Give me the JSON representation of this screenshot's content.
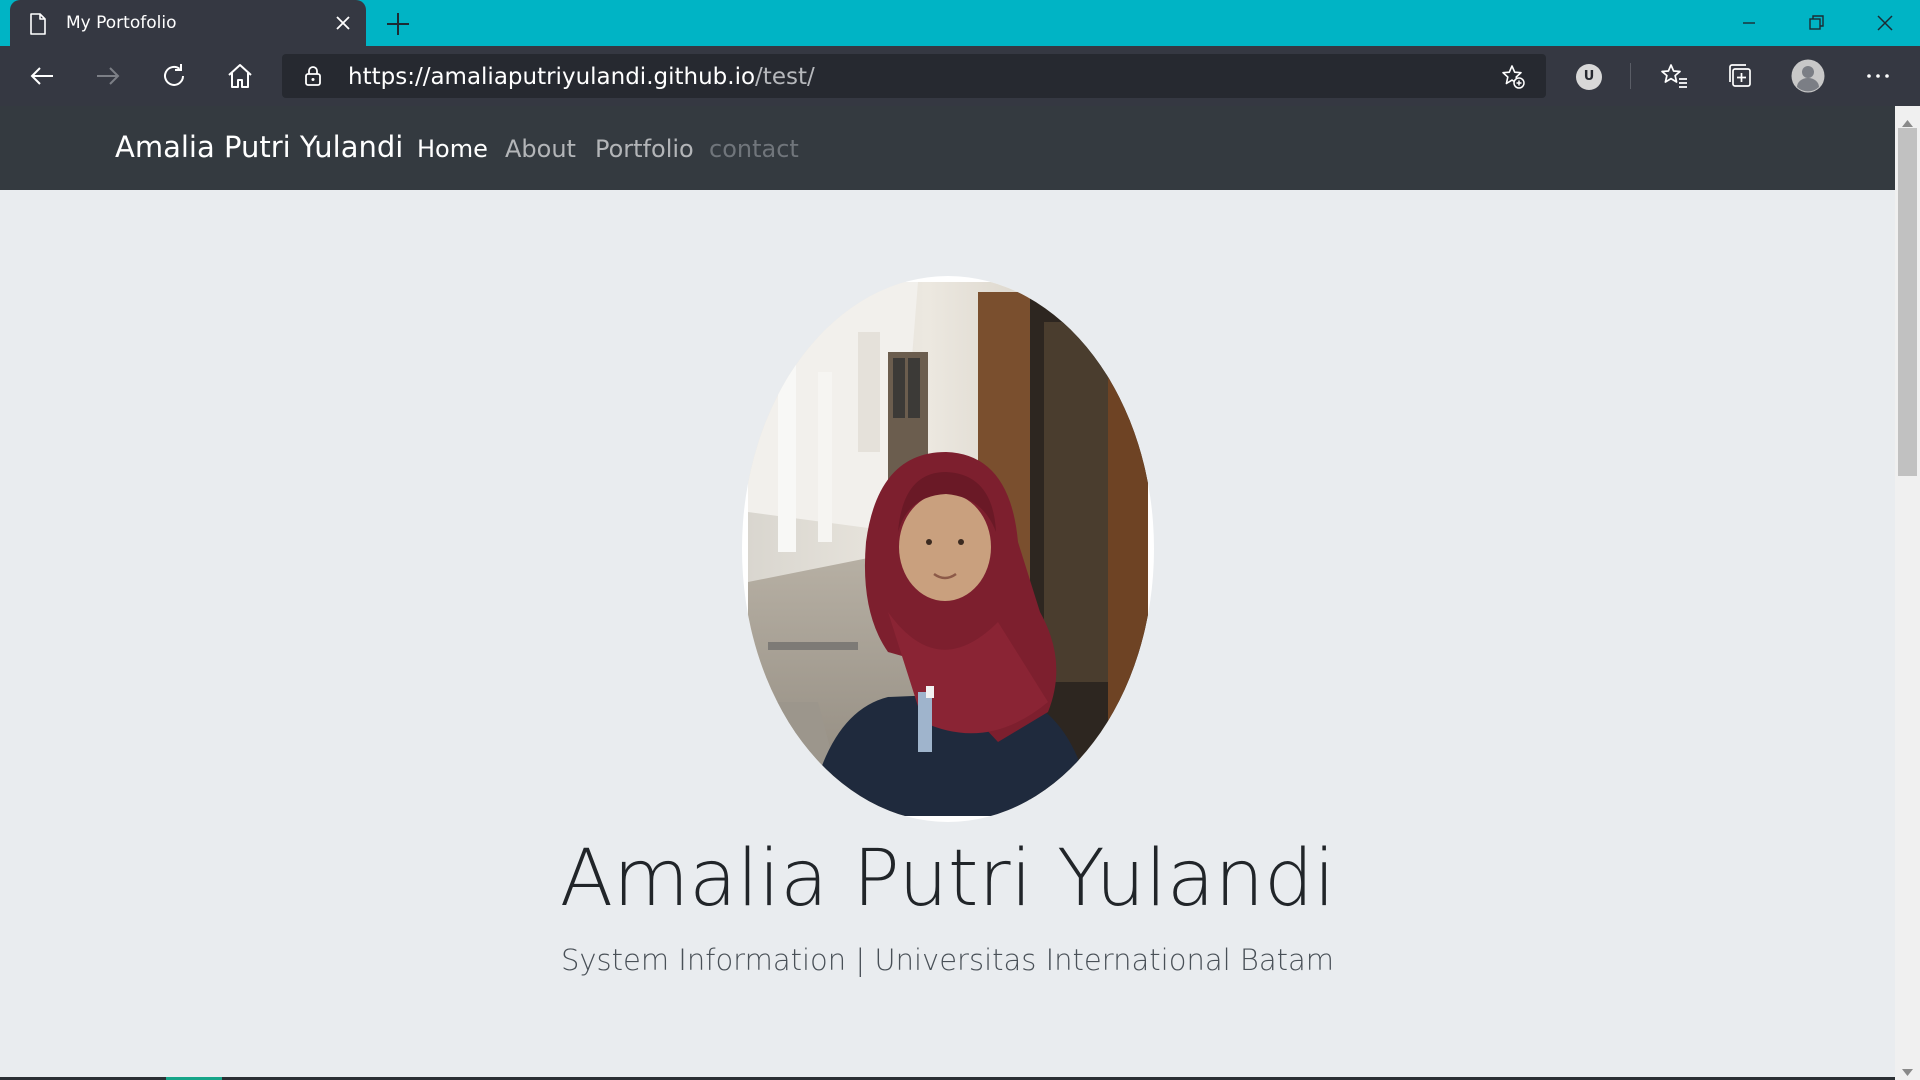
{
  "browser": {
    "tab_title": "My Portofolio",
    "url_host": "https://amaliaputriyulandi.github.io",
    "url_path": "/test/",
    "extension_label": "U",
    "tab_bg_color": "#353842",
    "titlebar_color": "#00b4c5",
    "icons": {
      "tab": "page-icon",
      "close_tab": "close-icon",
      "new_tab": "plus-icon",
      "minimize": "minimize-icon",
      "restore": "restore-icon",
      "close_window": "close-icon",
      "back": "back-arrow-icon",
      "forward": "forward-arrow-icon",
      "refresh": "refresh-icon",
      "home": "home-icon",
      "lock": "lock-icon",
      "add_favorite": "star-plus-icon",
      "favorites": "favorites-icon",
      "collections": "collections-icon",
      "profile": "profile-avatar-icon",
      "menu": "more-icon"
    }
  },
  "navbar": {
    "brand": "Amalia Putri Yulandi",
    "links": [
      {
        "label": "Home",
        "state": "active"
      },
      {
        "label": "About",
        "state": "normal"
      },
      {
        "label": "Portfolio",
        "state": "normal"
      },
      {
        "label": "contact",
        "state": "muted"
      }
    ],
    "bg_color": "#343a40"
  },
  "hero": {
    "name": "Amalia Putri Yulandi",
    "subtitle": "System Information | Universitas International Batam",
    "bg_color": "#e9ecef"
  }
}
